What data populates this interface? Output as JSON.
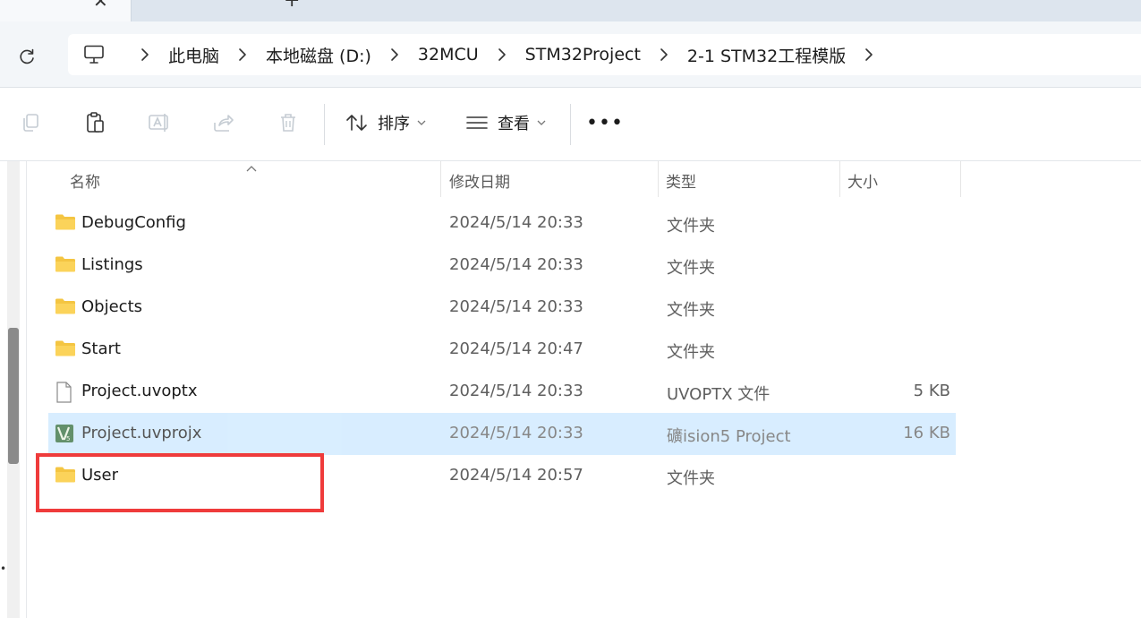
{
  "tabs": {
    "close_glyph": "✕",
    "new_glyph": "+"
  },
  "breadcrumb": {
    "items": [
      "此电脑",
      "本地磁盘 (D:)",
      "32MCU",
      "STM32Project",
      "2-1 STM32工程模版"
    ]
  },
  "toolbar": {
    "sort_label": "排序",
    "view_label": "查看",
    "more_label": "•••"
  },
  "columns": {
    "name": "名称",
    "modified": "修改日期",
    "type": "类型",
    "size": "大小"
  },
  "files": [
    {
      "name": "DebugConfig",
      "date": "2024/5/14 20:33",
      "type": "文件夹",
      "size": "",
      "icon": "folder-icon"
    },
    {
      "name": "Listings",
      "date": "2024/5/14 20:33",
      "type": "文件夹",
      "size": "",
      "icon": "folder-icon"
    },
    {
      "name": "Objects",
      "date": "2024/5/14 20:33",
      "type": "文件夹",
      "size": "",
      "icon": "folder-icon"
    },
    {
      "name": "Start",
      "date": "2024/5/14 20:47",
      "type": "文件夹",
      "size": "",
      "icon": "folder-icon"
    },
    {
      "name": "Project.uvoptx",
      "date": "2024/5/14 20:33",
      "type": "UVOPTX 文件",
      "size": "5 KB",
      "icon": "file-icon"
    },
    {
      "name": "Project.uvprojx",
      "date": "2024/5/14 20:33",
      "type": "礦ision5 Project",
      "size": "16 KB",
      "icon": "uvision-icon",
      "selected": true
    },
    {
      "name": "User",
      "date": "2024/5/14 20:57",
      "type": "文件夹",
      "size": "",
      "icon": "folder-icon"
    }
  ],
  "colors": {
    "selection": "#cce8ff",
    "folder": "#f4c542",
    "annotation_box": "#ef3b3b"
  }
}
